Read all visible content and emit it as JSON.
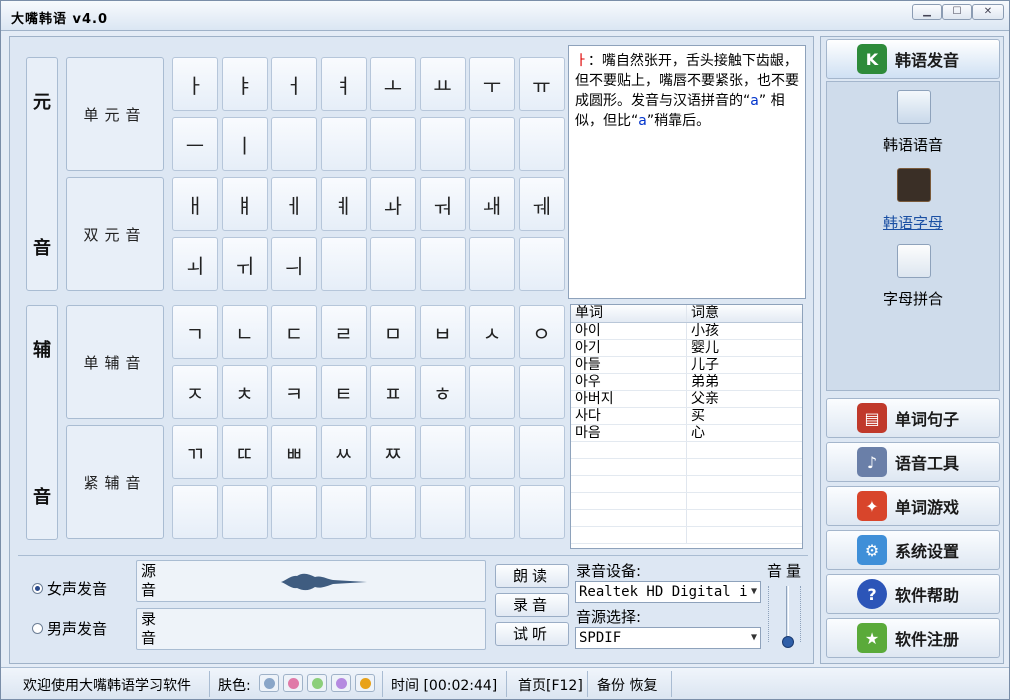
{
  "window": {
    "title": "大嘴韩语 v4.0"
  },
  "categories": {
    "vowel_top": "元",
    "vowel_bottom": "音",
    "cons_top": "辅",
    "cons_bottom": "音"
  },
  "groups": {
    "single_vowel": "单元音",
    "double_vowel": "双元音",
    "single_cons": "单辅音",
    "tense_cons": "紧辅音"
  },
  "jamo": {
    "single_vowel": [
      "ㅏ",
      "ㅑ",
      "ㅓ",
      "ㅕ",
      "ㅗ",
      "ㅛ",
      "ㅜ",
      "ㅠ",
      "ㅡ",
      "ㅣ"
    ],
    "double_vowel": [
      "ㅐ",
      "ㅒ",
      "ㅔ",
      "ㅖ",
      "ㅘ",
      "ㅝ",
      "ㅙ",
      "ㅞ",
      "ㅚ",
      "ㅟ",
      "ㅢ"
    ],
    "single_cons": [
      "ㄱ",
      "ㄴ",
      "ㄷ",
      "ㄹ",
      "ㅁ",
      "ㅂ",
      "ㅅ",
      "ㅇ",
      "ㅈ",
      "ㅊ",
      "ㅋ",
      "ㅌ",
      "ㅍ",
      "ㅎ"
    ],
    "tense_cons": [
      "ㄲ",
      "ㄸ",
      "ㅃ",
      "ㅆ",
      "ㅉ"
    ]
  },
  "description": {
    "jamo": "ㅏ",
    "part1": "：嘴自然张开，舌头接触下齿龈，但不要贴上，嘴唇不要紧张，也不要成圆形。发音与汉语拼音的“",
    "latin1": "a",
    "part2": "” 相似，但比“",
    "latin2": "a",
    "part3": "”稍靠后。"
  },
  "words": {
    "col_word": "单词",
    "col_meaning": "词意",
    "rows": [
      {
        "word": "아이",
        "meaning": "小孩"
      },
      {
        "word": "아기",
        "meaning": "婴儿"
      },
      {
        "word": "아들",
        "meaning": "儿子"
      },
      {
        "word": "아우",
        "meaning": "弟弟"
      },
      {
        "word": "아버지",
        "meaning": "父亲"
      },
      {
        "word": "사다",
        "meaning": "买"
      },
      {
        "word": "마음",
        "meaning": "心"
      }
    ]
  },
  "voice": {
    "female": "女声发音",
    "male": "男声发音"
  },
  "wave": {
    "source": "源音",
    "record": "录音"
  },
  "buttons": {
    "read": "朗读",
    "record": "录音",
    "listen": "试听"
  },
  "recorder": {
    "device_label": "录音设备:",
    "device_value": "Realtek HD Digital i",
    "source_label": "音源选择:",
    "source_value": "SPDIF",
    "volume_label": "音量"
  },
  "side": {
    "pronounce": "韩语发音",
    "sub_items": [
      "韩语语音",
      "韩语字母",
      "字母拼合"
    ],
    "words": "单词句子",
    "tools": "语音工具",
    "game": "单词游戏",
    "settings": "系统设置",
    "help": "软件帮助",
    "register": "软件注册"
  },
  "status": {
    "welcome": "欢迎使用大嘴韩语学习软件",
    "skin_label": "肤色:",
    "time": "时间 [00:02:44]",
    "home": "首页[F12]",
    "backup": "备份 恢复"
  },
  "colors": {
    "skins": [
      "#8aa6c8",
      "#e07aa8",
      "#8ccf7a",
      "#b58ae0",
      "#e8a21a"
    ]
  }
}
